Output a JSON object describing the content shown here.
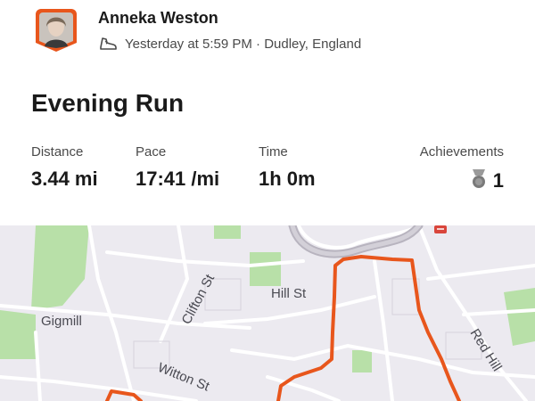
{
  "athlete": {
    "name": "Anneka Weston",
    "activity_icon": "running-shoe-icon",
    "time_location": "Yesterday at 5:59 PM · Dudley, England"
  },
  "activity": {
    "title": "Evening Run"
  },
  "stats": [
    {
      "label": "Distance",
      "value": "3.44 mi"
    },
    {
      "label": "Pace",
      "value": "17:41 /mi"
    },
    {
      "label": "Time",
      "value": "1h 0m"
    },
    {
      "label": "Achievements",
      "value": "1",
      "icon": "medal-icon"
    }
  ],
  "map": {
    "labels": [
      "Clifton St",
      "Hill St",
      "Gigmill",
      "Witton St",
      "Red Hill"
    ],
    "route_color": "#e8561c"
  },
  "colors": {
    "accent": "#fc4c02",
    "map_background": "#eceaf0",
    "park": "#b8e0a8"
  }
}
